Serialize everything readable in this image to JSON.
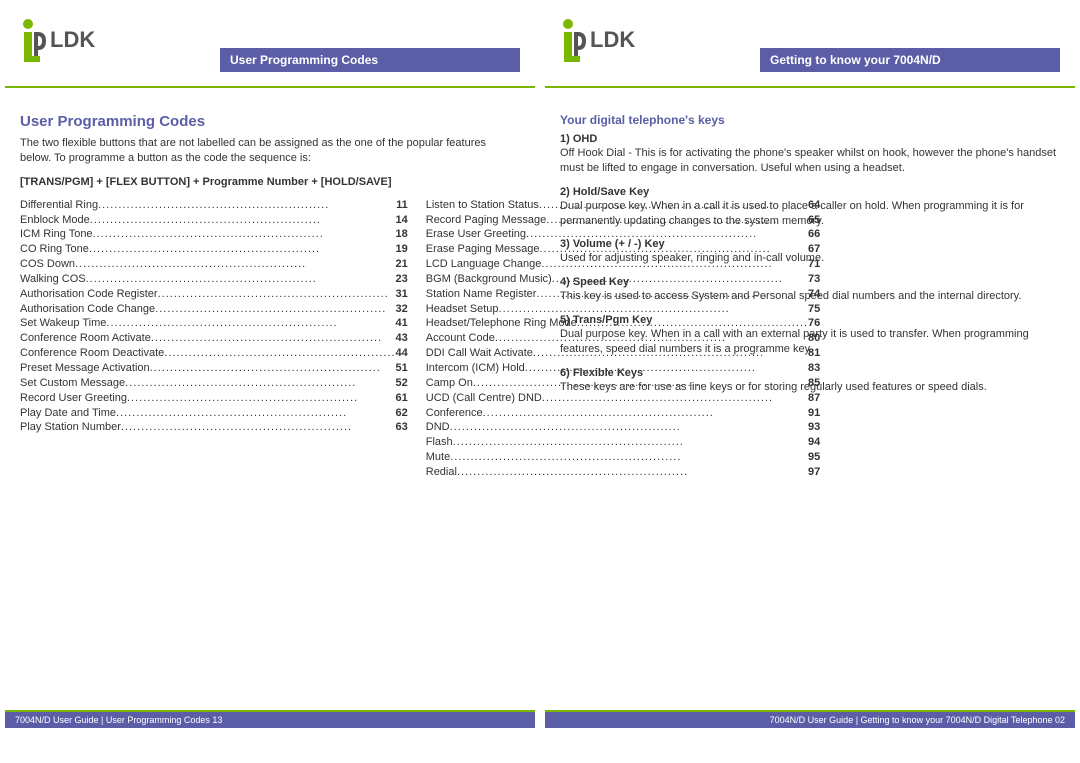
{
  "logo_text": "LDK",
  "left": {
    "header_title": "User Programming Codes",
    "section_title": "User Programming Codes",
    "intro": "The two flexible buttons that are not labelled can be assigned as the one of the popular features below. To programme a button as the code the sequence is:",
    "sequence": "[TRANS/PGM] + [FLEX BUTTON] + Programme Number + [HOLD/SAVE]",
    "codes_col1": [
      {
        "label": "Differential Ring",
        "num": "11"
      },
      {
        "label": "Enblock Mode",
        "num": "14"
      },
      {
        "label": "ICM Ring Tone",
        "num": "18"
      },
      {
        "label": "CO Ring Tone",
        "num": "19"
      },
      {
        "label": "COS Down",
        "num": "21"
      },
      {
        "label": "Walking COS",
        "num": "23"
      },
      {
        "label": "Authorisation Code Register",
        "num": "31"
      },
      {
        "label": "Authorisation Code Change",
        "num": "32"
      },
      {
        "label": "Set Wakeup Time",
        "num": "41"
      },
      {
        "label": "Conference Room Activate",
        "num": "43"
      },
      {
        "label": "Conference Room Deactivate",
        "num": "44"
      },
      {
        "label": "Preset Message Activation",
        "num": "51"
      },
      {
        "label": "Set Custom Message",
        "num": "52"
      },
      {
        "label": "Record User Greeting",
        "num": "61"
      },
      {
        "label": "Play Date and Time",
        "num": "62"
      },
      {
        "label": "Play Station Number",
        "num": "63"
      }
    ],
    "codes_col2": [
      {
        "label": "Listen to Station Status",
        "num": "64"
      },
      {
        "label": "Record Paging Message",
        "num": "65"
      },
      {
        "label": "Erase User Greeting",
        "num": "66"
      },
      {
        "label": "Erase Paging Message",
        "num": "67"
      },
      {
        "label": "LCD Language Change",
        "num": "71"
      },
      {
        "label": "BGM (Background Music)",
        "num": "73"
      },
      {
        "label": "Station Name Register",
        "num": "74"
      },
      {
        "label": "Headset Setup",
        "num": "75"
      },
      {
        "label": "Headset/Telephone Ring Mode",
        "num": "76"
      },
      {
        "label": "Account Code",
        "num": "80"
      },
      {
        "label": "DDI Call Wait Activate",
        "num": "81"
      },
      {
        "label": "Intercom (ICM) Hold",
        "num": "83"
      },
      {
        "label": "Camp On",
        "num": "85"
      },
      {
        "label": "UCD (Call Centre) DND",
        "num": "87"
      },
      {
        "label": "Conference",
        "num": "91"
      },
      {
        "label": "DND",
        "num": "93"
      },
      {
        "label": "Flash",
        "num": "94"
      },
      {
        "label": "Mute",
        "num": "95"
      },
      {
        "label": "Redial",
        "num": "97"
      }
    ],
    "footer": "7004N/D User Guide | User Programming Codes 13"
  },
  "right": {
    "header_title": "Getting to know your 7004N/D",
    "section_title": "Your digital telephone's keys",
    "keys": [
      {
        "heading": "1) OHD",
        "text": "Off Hook Dial - This is for activating the phone's speaker whilst on hook, however the phone's handset must be lifted to engage in conversation. Useful when using a headset."
      },
      {
        "heading": "2) Hold/Save Key",
        "text": "Dual purpose key. When in a call it is used to place a caller on hold. When programming it is for permanently updating changes to the system memory."
      },
      {
        "heading": "3) Volume (+ / -) Key",
        "text": "Used for adjusting speaker, ringing and in-call volume."
      },
      {
        "heading": "4) Speed Key",
        "text": "This key is used to access System and Personal speed dial numbers and the internal directory."
      },
      {
        "heading": "5) Trans/Pgm Key",
        "text": "Dual purpose key. When in a call with an external party it is used to transfer. When programming features, speed dial numbers it is a programme key."
      },
      {
        "heading": "6) Flexible Keys",
        "text": "These keys are for use as line keys or for storing regularly used features or speed dials."
      }
    ],
    "footer": "7004N/D User Guide | Getting to know your 7004N/D Digital Telephone 02"
  }
}
